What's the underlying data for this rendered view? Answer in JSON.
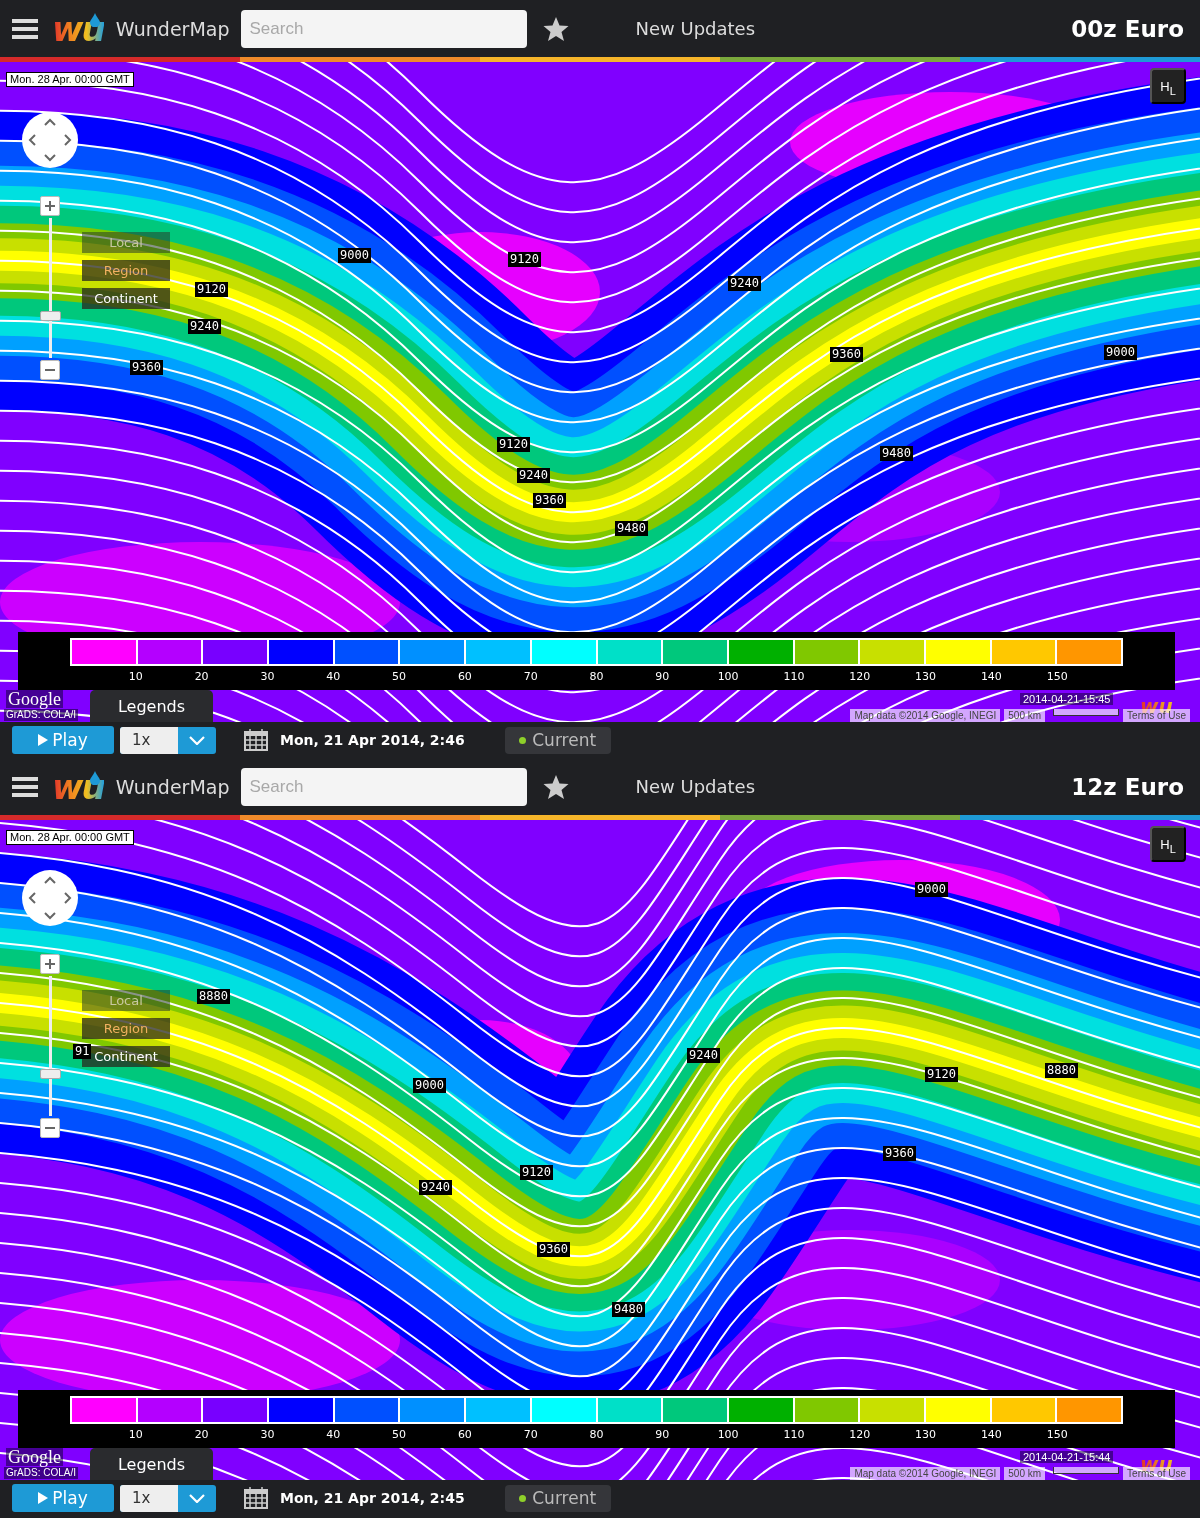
{
  "panels": [
    {
      "header": {
        "app_name": "WunderMap",
        "logo_mark": "wu",
        "search": {
          "placeholder": "Search"
        },
        "updates_link": "New Updates",
        "title": "00z Euro"
      },
      "map": {
        "valid_time": "Mon. 28 Apr. 00:00 GMT",
        "hl_toggle": {
          "high": "H",
          "low": "L"
        },
        "zoom": {
          "level": 0.31
        },
        "layers": [
          {
            "label": "Local",
            "selected": false,
            "disabled": true
          },
          {
            "label": "Region",
            "selected": true,
            "disabled": false
          },
          {
            "label": "Continent",
            "selected": false,
            "disabled": false
          }
        ],
        "contour_labels": [
          "9000",
          "9120",
          "9240",
          "9120",
          "9240",
          "9360",
          "9000",
          "9360",
          "9120",
          "9240",
          "9360",
          "9480",
          "9480"
        ],
        "legend": {
          "ticks": [
            "10",
            "20",
            "30",
            "40",
            "50",
            "60",
            "70",
            "80",
            "90",
            "100",
            "110",
            "120",
            "130",
            "140",
            "150"
          ]
        },
        "legends_button": "Legends",
        "provider_logo": "Google",
        "source_credit": "GrADS: COLA/I",
        "watermark_logo": "wu",
        "map_timestamp": "2014-04-21-15:45",
        "map_data": "Map data ©2014 Google, INEGI",
        "scale": "500 km",
        "terms": "Terms of Use"
      },
      "controls": {
        "play": "Play",
        "speed": "1x",
        "date": "Mon, 21 Apr 2014, 2:46",
        "current": "Current"
      }
    },
    {
      "header": {
        "app_name": "WunderMap",
        "logo_mark": "wu",
        "search": {
          "placeholder": "Search"
        },
        "updates_link": "New Updates",
        "title": "12z Euro"
      },
      "map": {
        "valid_time": "Mon. 28 Apr. 00:00 GMT",
        "hl_toggle": {
          "high": "H",
          "low": "L"
        },
        "zoom": {
          "level": 0.31
        },
        "layers": [
          {
            "label": "Local",
            "selected": false,
            "disabled": true
          },
          {
            "label": "Region",
            "selected": true,
            "disabled": false
          },
          {
            "label": "Continent",
            "selected": false,
            "disabled": false
          }
        ],
        "contour_labels": [
          "9000",
          "8880",
          "91",
          "9240",
          "9000",
          "9120",
          "8880",
          "9360",
          "9120",
          "9240",
          "9360",
          "9480"
        ],
        "legend": {
          "ticks": [
            "10",
            "20",
            "30",
            "40",
            "50",
            "60",
            "70",
            "80",
            "90",
            "100",
            "110",
            "120",
            "130",
            "140",
            "150"
          ]
        },
        "legends_button": "Legends",
        "provider_logo": "Google",
        "source_credit": "GrADS: COLA/I",
        "watermark_logo": "wu",
        "map_timestamp": "2014-04-21-15:44",
        "map_data": "Map data ©2014 Google, INEGI",
        "scale": "500 km",
        "terms": "Terms of Use"
      },
      "controls": {
        "play": "Play",
        "speed": "1x",
        "date": "Mon, 21 Apr 2014, 2:45",
        "current": "Current"
      }
    }
  ],
  "legend_colors": [
    {
      "color": "#ff00ff"
    },
    {
      "color": "#b400ff"
    },
    {
      "color": "#7800ff"
    },
    {
      "color": "#0000ff"
    },
    {
      "color": "#0050ff"
    },
    {
      "color": "#0090ff"
    },
    {
      "color": "#00c0ff"
    },
    {
      "color": "#00ffff"
    },
    {
      "color": "#00e0c8"
    },
    {
      "color": "#00c87c"
    },
    {
      "color": "#00b000"
    },
    {
      "color": "#80c800"
    },
    {
      "color": "#c8e000"
    },
    {
      "color": "#ffff00"
    },
    {
      "color": "#ffc800"
    },
    {
      "color": "#ff9600"
    }
  ]
}
